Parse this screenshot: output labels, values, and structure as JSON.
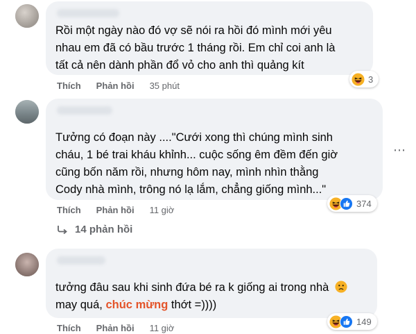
{
  "comments": [
    {
      "text_lines": [
        "Rồi một ngày nào đó vợ sẽ nói ra hồi đó mình mới yêu",
        "nhau em đã có bầu trước 1 tháng rồi. Em chỉ coi anh là",
        "tất cả nên dành phần đổ vỏ cho anh thì quảng kít"
      ],
      "like_label": "Thích",
      "reply_label": "Phản hồi",
      "time": "35 phút",
      "reaction_count": "3",
      "reactions": [
        "haha-icon"
      ]
    },
    {
      "text_lines": [
        "Tưởng có đoạn này ....\"Cưới xong thì chúng mình sinh",
        "cháu, 1 bé trai kháu khỉnh... cuộc sống êm đềm đến giờ",
        "cũng bốn năm rồi, nhưng hôm nay, mình nhìn thằng",
        "Cody nhà mình, trông nó lạ lắm, chẳng giống mình...\""
      ],
      "like_label": "Thích",
      "reply_label": "Phản hồi",
      "time": "11 giờ",
      "reaction_count": "374",
      "reactions": [
        "haha-icon",
        "like-icon"
      ],
      "replies_label": "14 phản hồi"
    },
    {
      "line1": "tưởng đâu sau khi sinh đứa bé ra k giống ai trong nhà",
      "line2_before": "may quá, ",
      "line2_highlight": "chúc mừng",
      "line2_after": " thớt =))))",
      "like_label": "Thích",
      "reply_label": "Phản hồi",
      "time": "11 giờ",
      "reaction_count": "149",
      "reactions": [
        "haha-icon",
        "like-icon"
      ]
    }
  ],
  "colors": {
    "bubble": "#f0f2f5",
    "secondary_text": "#65676b",
    "highlight": "#e4542a",
    "like_blue": "#1877f2",
    "haha_yellow": "#f7b125"
  }
}
